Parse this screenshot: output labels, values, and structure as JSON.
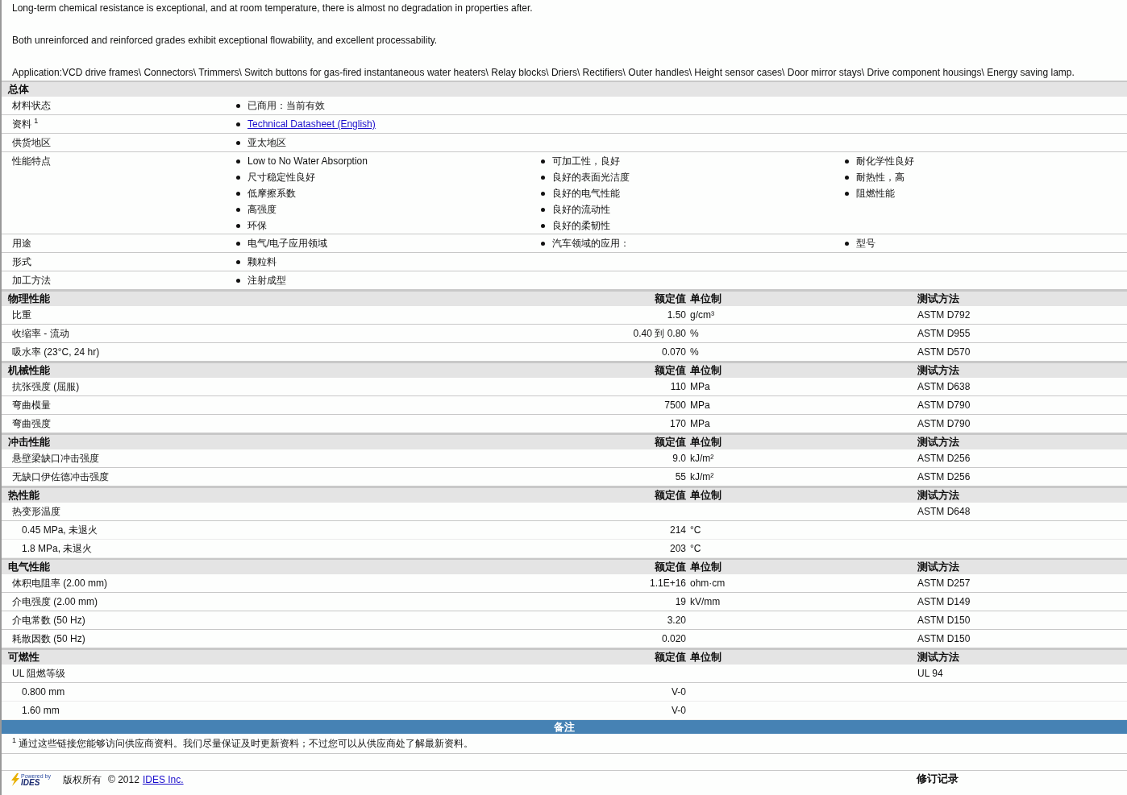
{
  "intro": [
    "Long-term chemical resistance is exceptional, and at room temperature, there is almost no degradation in properties after.",
    "Both unreinforced and reinforced grades exhibit exceptional flowability, and excellent processability.",
    "Application:VCD drive frames\\ Connectors\\ Trimmers\\ Switch buttons for gas-fired instantaneous water heaters\\ Relay blocks\\ Driers\\ Rectifiers\\ Outer handles\\ Height sensor cases\\ Door mirror stays\\ Drive component housings\\ Energy saving lamp."
  ],
  "general": {
    "title": "总体",
    "rows": [
      {
        "label": "材料状态",
        "columns": [
          [
            {
              "kind": "text",
              "text": "已商用：当前有效"
            }
          ]
        ]
      },
      {
        "label": "资料 $^{1}$",
        "columns": [
          [
            {
              "kind": "link",
              "text": "Technical Datasheet (English)"
            }
          ]
        ]
      },
      {
        "label": "供货地区",
        "columns": [
          [
            {
              "kind": "text",
              "text": "亚太地区"
            }
          ]
        ]
      },
      {
        "label": "性能特点",
        "columns": [
          [
            {
              "kind": "text",
              "text": "Low to No Water Absorption"
            },
            {
              "kind": "text",
              "text": "尺寸稳定性良好"
            },
            {
              "kind": "text",
              "text": "低摩擦系数"
            },
            {
              "kind": "text",
              "text": "高强度"
            },
            {
              "kind": "text",
              "text": "环保"
            }
          ],
          [
            {
              "kind": "text",
              "text": "可加工性，良好"
            },
            {
              "kind": "text",
              "text": "良好的表面光洁度"
            },
            {
              "kind": "text",
              "text": "良好的电气性能"
            },
            {
              "kind": "text",
              "text": "良好的流动性"
            },
            {
              "kind": "text",
              "text": "良好的柔韧性"
            }
          ],
          [
            {
              "kind": "text",
              "text": "耐化学性良好"
            },
            {
              "kind": "text",
              "text": "耐热性，高"
            },
            {
              "kind": "text",
              "text": "阻燃性能"
            }
          ]
        ]
      },
      {
        "label": "用途",
        "columns": [
          [
            {
              "kind": "text",
              "text": "电气/电子应用领域"
            }
          ],
          [
            {
              "kind": "text",
              "text": "汽车领域的应用："
            }
          ],
          [
            {
              "kind": "text",
              "text": "型号"
            }
          ]
        ]
      },
      {
        "label": "形式",
        "columns": [
          [
            {
              "kind": "text",
              "text": "颗粒料"
            }
          ]
        ]
      },
      {
        "label": "加工方法",
        "columns": [
          [
            {
              "kind": "text",
              "text": "注射成型"
            }
          ]
        ]
      }
    ]
  },
  "sections": [
    {
      "title": "物理性能",
      "value_header": "额定值",
      "unit_header": "单位制",
      "method_header": "测试方法",
      "rows": [
        {
          "kind": "main",
          "label": "比重",
          "value": "1.50",
          "unit": "g/cm³",
          "method": "ASTM D792"
        },
        {
          "kind": "main",
          "label": "收缩率 - 流动",
          "value": "0.40 到 0.80",
          "unit": "%",
          "method": "ASTM D955"
        },
        {
          "kind": "main",
          "label": "吸水率 (23°C, 24 hr)",
          "value": "0.070",
          "unit": "%",
          "method": "ASTM D570"
        }
      ]
    },
    {
      "title": "机械性能",
      "value_header": "额定值",
      "unit_header": "单位制",
      "method_header": "测试方法",
      "rows": [
        {
          "kind": "main",
          "label": "抗张强度 (屈服)",
          "value": "110",
          "unit": "MPa",
          "method": "ASTM D638"
        },
        {
          "kind": "main",
          "label": "弯曲模量",
          "value": "7500",
          "unit": "MPa",
          "method": "ASTM D790"
        },
        {
          "kind": "main",
          "label": "弯曲强度",
          "value": "170",
          "unit": "MPa",
          "method": "ASTM D790"
        }
      ]
    },
    {
      "title": "冲击性能",
      "value_header": "额定值",
      "unit_header": "单位制",
      "method_header": "测试方法",
      "rows": [
        {
          "kind": "main",
          "label": "悬壁梁缺口冲击强度",
          "value": "9.0",
          "unit": "kJ/m²",
          "method": "ASTM D256"
        },
        {
          "kind": "main",
          "label": "无缺口伊佐德冲击强度",
          "value": "55",
          "unit": "kJ/m²",
          "method": "ASTM D256"
        }
      ]
    },
    {
      "title": "热性能",
      "value_header": "额定值",
      "unit_header": "单位制",
      "method_header": "测试方法",
      "rows": [
        {
          "kind": "main",
          "label": "热变形温度",
          "method": "ASTM D648"
        },
        {
          "kind": "sub",
          "label": "0.45 MPa, 未退火",
          "value": "214",
          "unit": "°C"
        },
        {
          "kind": "sub",
          "label": "1.8 MPa, 未退火",
          "value": "203",
          "unit": "°C"
        }
      ]
    },
    {
      "title": "电气性能",
      "value_header": "额定值",
      "unit_header": "单位制",
      "method_header": "测试方法",
      "rows": [
        {
          "kind": "main",
          "label": "体积电阻率 (2.00 mm)",
          "value": "1.1E+16",
          "unit": "ohm·cm",
          "method": "ASTM D257"
        },
        {
          "kind": "main",
          "label": "介电强度 (2.00 mm)",
          "value": "19",
          "unit": "kV/mm",
          "method": "ASTM D149"
        },
        {
          "kind": "main",
          "label": "介电常数 (50 Hz)",
          "value": "3.20",
          "method": "ASTM D150"
        },
        {
          "kind": "main",
          "label": "耗散因数 (50 Hz)",
          "value": "0.020",
          "method": "ASTM D150"
        }
      ]
    },
    {
      "title": "可燃性",
      "value_header": "额定值",
      "unit_header": "单位制",
      "method_header": "测试方法",
      "rows": [
        {
          "kind": "main",
          "label": "UL 阻燃等级",
          "method": "UL 94"
        },
        {
          "kind": "sub",
          "label": "0.800 mm",
          "value": "V-0"
        },
        {
          "kind": "sub",
          "label": "1.60 mm",
          "value": "V-0"
        }
      ]
    }
  ],
  "notes": {
    "title": "备注",
    "footnote_mark": "1",
    "footnote": "通过这些链接您能够访问供应商资料。我们尽量保证及时更新资料；不过您可以从供应商处了解最新资料。"
  },
  "footer": {
    "logo_caption": "Powered by",
    "logo_name": "IDES",
    "copyright": "版权所有",
    "year": "© 2012",
    "company": "IDES Inc.",
    "revision_title": "修订记录"
  }
}
